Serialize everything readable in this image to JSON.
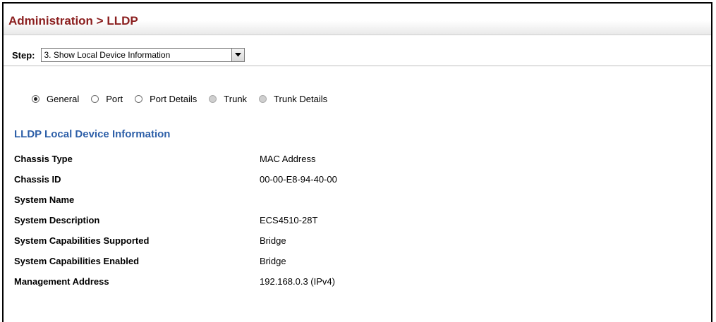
{
  "header": {
    "breadcrumb": "Administration > LLDP"
  },
  "step": {
    "label": "Step:",
    "selected": "3. Show Local Device Information"
  },
  "view_options": [
    {
      "label": "General",
      "checked": true,
      "enabled": true
    },
    {
      "label": "Port",
      "checked": false,
      "enabled": true
    },
    {
      "label": "Port Details",
      "checked": false,
      "enabled": true
    },
    {
      "label": "Trunk",
      "checked": false,
      "enabled": false
    },
    {
      "label": "Trunk Details",
      "checked": false,
      "enabled": false
    }
  ],
  "section": {
    "title": "LLDP Local Device Information"
  },
  "info": [
    {
      "key": "Chassis Type",
      "value": "MAC Address"
    },
    {
      "key": "Chassis ID",
      "value": "00-00-E8-94-40-00"
    },
    {
      "key": "System Name",
      "value": ""
    },
    {
      "key": "System Description",
      "value": "ECS4510-28T"
    },
    {
      "key": "System Capabilities Supported",
      "value": "Bridge"
    },
    {
      "key": "System Capabilities Enabled",
      "value": "Bridge"
    },
    {
      "key": "Management Address",
      "value": "192.168.0.3 (IPv4)"
    }
  ],
  "colors": {
    "title": "#8b1f1f",
    "section": "#2d5fa8"
  }
}
